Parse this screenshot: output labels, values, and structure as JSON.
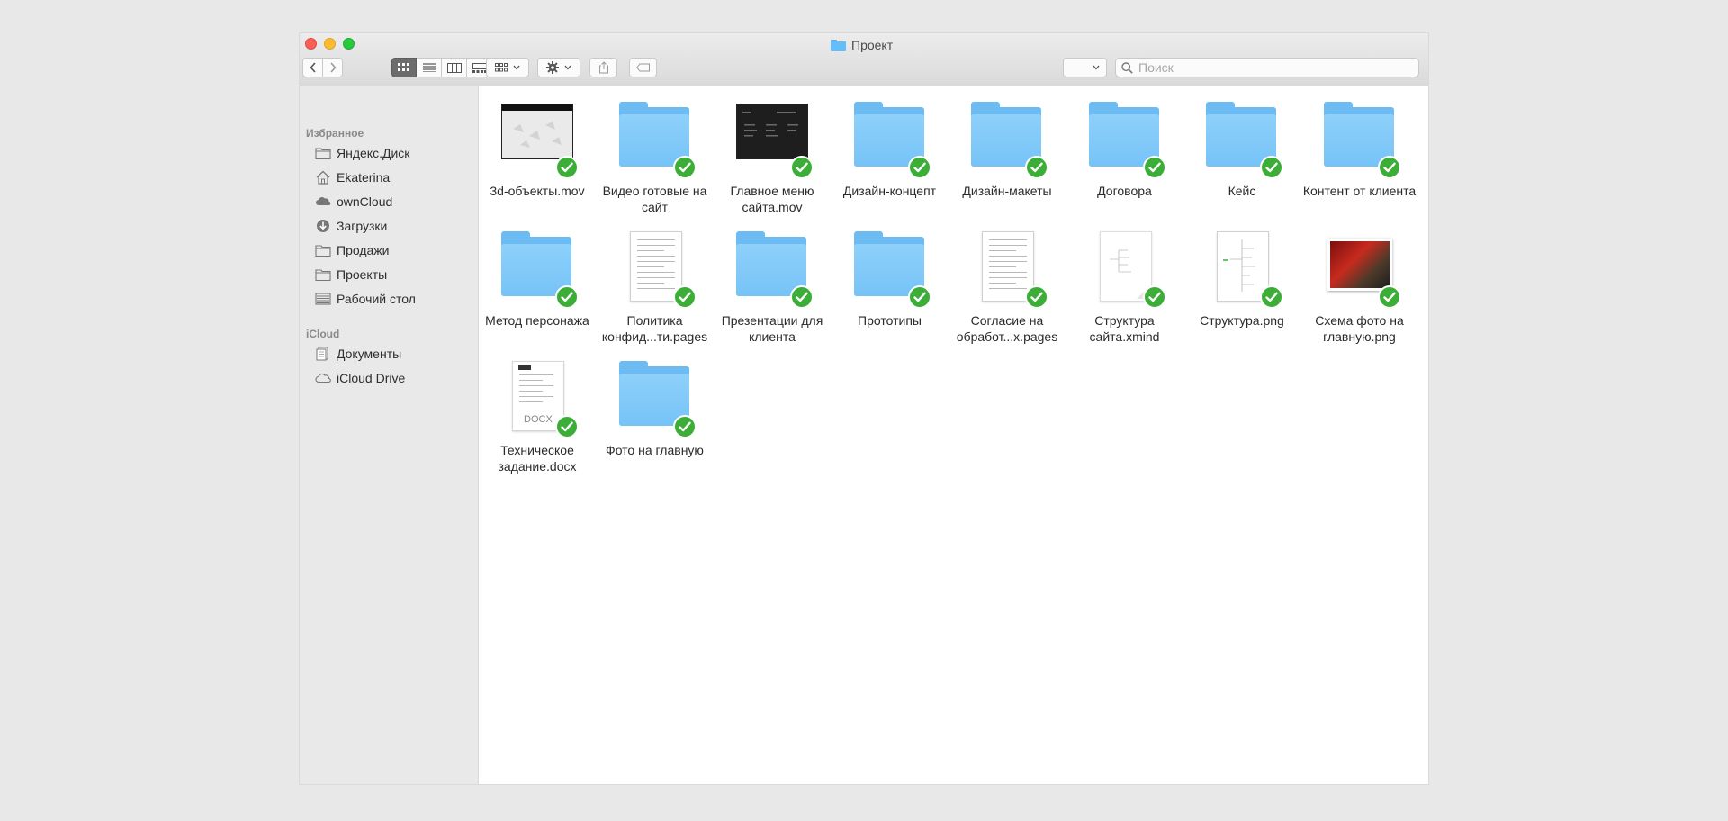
{
  "window": {
    "title": "Проект"
  },
  "toolbar": {
    "view_modes": [
      "icon-view-icon",
      "list-view-icon",
      "column-view-icon",
      "gallery-view-icon"
    ],
    "active_view": 0,
    "search_placeholder": "Поиск"
  },
  "sidebar": {
    "sections": [
      {
        "title": "Избранное",
        "items": [
          {
            "label": "Яндекс.Диск",
            "icon": "folder-icon"
          },
          {
            "label": "Ekaterina",
            "icon": "home-icon"
          },
          {
            "label": "ownCloud",
            "icon": "cloud-icon"
          },
          {
            "label": "Загрузки",
            "icon": "downloads-icon"
          },
          {
            "label": "Продажи",
            "icon": "folder-icon"
          },
          {
            "label": "Проекты",
            "icon": "folder-icon"
          },
          {
            "label": "Рабочий стол",
            "icon": "desktop-icon"
          }
        ]
      },
      {
        "title": "iCloud",
        "items": [
          {
            "label": "Документы",
            "icon": "documents-icon"
          },
          {
            "label": "iCloud Drive",
            "icon": "icloud-icon"
          }
        ]
      }
    ]
  },
  "files": [
    {
      "name": "3d-объекты.mov",
      "kind": "video-light",
      "synced": true
    },
    {
      "name": "Видео готовые на сайт",
      "kind": "folder",
      "synced": true
    },
    {
      "name": "Главное меню сайта.mov",
      "kind": "video-dark",
      "synced": true
    },
    {
      "name": "Дизайн-концепт",
      "kind": "folder",
      "synced": true
    },
    {
      "name": "Дизайн-макеты",
      "kind": "folder",
      "synced": true
    },
    {
      "name": "Договора",
      "kind": "folder",
      "synced": true
    },
    {
      "name": "Кейс",
      "kind": "folder",
      "synced": true
    },
    {
      "name": "Контент от клиента",
      "kind": "folder",
      "synced": true
    },
    {
      "name": "Метод персонажа",
      "kind": "folder",
      "synced": true
    },
    {
      "name": "Политика конфид...ти.pages",
      "kind": "document",
      "synced": true
    },
    {
      "name": "Презентации для клиента",
      "kind": "folder",
      "synced": true
    },
    {
      "name": "Прототипы",
      "kind": "folder",
      "synced": true
    },
    {
      "name": "Согласие на обработ...х.pages",
      "kind": "document",
      "synced": true
    },
    {
      "name": "Структура сайта.xmind",
      "kind": "xmind",
      "synced": true
    },
    {
      "name": "Структура.png",
      "kind": "diagram",
      "synced": true
    },
    {
      "name": "Схема фото на главную.png",
      "kind": "photo",
      "synced": true
    },
    {
      "name": "Техническое задание.docx",
      "kind": "docx",
      "badge": "DOCX",
      "synced": true
    },
    {
      "name": "Фото на главную",
      "kind": "folder",
      "synced": true
    }
  ]
}
